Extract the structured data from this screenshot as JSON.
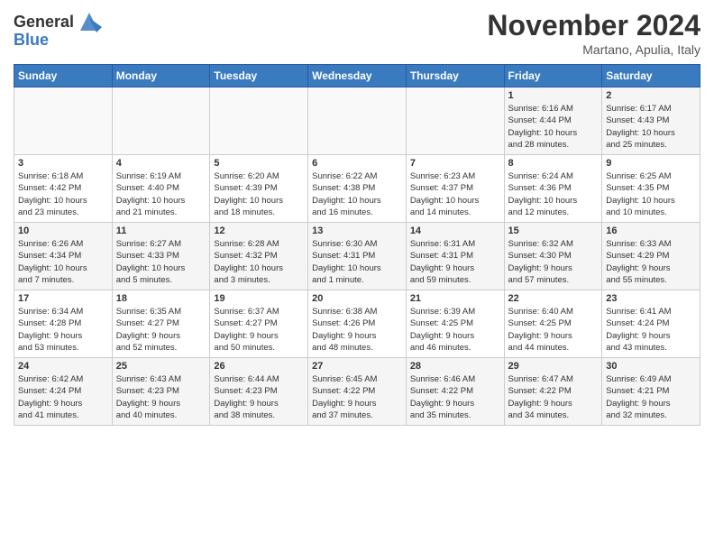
{
  "header": {
    "logo_line1": "General",
    "logo_line2": "Blue",
    "month_title": "November 2024",
    "subtitle": "Martano, Apulia, Italy"
  },
  "days_of_week": [
    "Sunday",
    "Monday",
    "Tuesday",
    "Wednesday",
    "Thursday",
    "Friday",
    "Saturday"
  ],
  "weeks": [
    [
      {
        "day": "",
        "info": ""
      },
      {
        "day": "",
        "info": ""
      },
      {
        "day": "",
        "info": ""
      },
      {
        "day": "",
        "info": ""
      },
      {
        "day": "",
        "info": ""
      },
      {
        "day": "1",
        "info": "Sunrise: 6:16 AM\nSunset: 4:44 PM\nDaylight: 10 hours\nand 28 minutes."
      },
      {
        "day": "2",
        "info": "Sunrise: 6:17 AM\nSunset: 4:43 PM\nDaylight: 10 hours\nand 25 minutes."
      }
    ],
    [
      {
        "day": "3",
        "info": "Sunrise: 6:18 AM\nSunset: 4:42 PM\nDaylight: 10 hours\nand 23 minutes."
      },
      {
        "day": "4",
        "info": "Sunrise: 6:19 AM\nSunset: 4:40 PM\nDaylight: 10 hours\nand 21 minutes."
      },
      {
        "day": "5",
        "info": "Sunrise: 6:20 AM\nSunset: 4:39 PM\nDaylight: 10 hours\nand 18 minutes."
      },
      {
        "day": "6",
        "info": "Sunrise: 6:22 AM\nSunset: 4:38 PM\nDaylight: 10 hours\nand 16 minutes."
      },
      {
        "day": "7",
        "info": "Sunrise: 6:23 AM\nSunset: 4:37 PM\nDaylight: 10 hours\nand 14 minutes."
      },
      {
        "day": "8",
        "info": "Sunrise: 6:24 AM\nSunset: 4:36 PM\nDaylight: 10 hours\nand 12 minutes."
      },
      {
        "day": "9",
        "info": "Sunrise: 6:25 AM\nSunset: 4:35 PM\nDaylight: 10 hours\nand 10 minutes."
      }
    ],
    [
      {
        "day": "10",
        "info": "Sunrise: 6:26 AM\nSunset: 4:34 PM\nDaylight: 10 hours\nand 7 minutes."
      },
      {
        "day": "11",
        "info": "Sunrise: 6:27 AM\nSunset: 4:33 PM\nDaylight: 10 hours\nand 5 minutes."
      },
      {
        "day": "12",
        "info": "Sunrise: 6:28 AM\nSunset: 4:32 PM\nDaylight: 10 hours\nand 3 minutes."
      },
      {
        "day": "13",
        "info": "Sunrise: 6:30 AM\nSunset: 4:31 PM\nDaylight: 10 hours\nand 1 minute."
      },
      {
        "day": "14",
        "info": "Sunrise: 6:31 AM\nSunset: 4:31 PM\nDaylight: 9 hours\nand 59 minutes."
      },
      {
        "day": "15",
        "info": "Sunrise: 6:32 AM\nSunset: 4:30 PM\nDaylight: 9 hours\nand 57 minutes."
      },
      {
        "day": "16",
        "info": "Sunrise: 6:33 AM\nSunset: 4:29 PM\nDaylight: 9 hours\nand 55 minutes."
      }
    ],
    [
      {
        "day": "17",
        "info": "Sunrise: 6:34 AM\nSunset: 4:28 PM\nDaylight: 9 hours\nand 53 minutes."
      },
      {
        "day": "18",
        "info": "Sunrise: 6:35 AM\nSunset: 4:27 PM\nDaylight: 9 hours\nand 52 minutes."
      },
      {
        "day": "19",
        "info": "Sunrise: 6:37 AM\nSunset: 4:27 PM\nDaylight: 9 hours\nand 50 minutes."
      },
      {
        "day": "20",
        "info": "Sunrise: 6:38 AM\nSunset: 4:26 PM\nDaylight: 9 hours\nand 48 minutes."
      },
      {
        "day": "21",
        "info": "Sunrise: 6:39 AM\nSunset: 4:25 PM\nDaylight: 9 hours\nand 46 minutes."
      },
      {
        "day": "22",
        "info": "Sunrise: 6:40 AM\nSunset: 4:25 PM\nDaylight: 9 hours\nand 44 minutes."
      },
      {
        "day": "23",
        "info": "Sunrise: 6:41 AM\nSunset: 4:24 PM\nDaylight: 9 hours\nand 43 minutes."
      }
    ],
    [
      {
        "day": "24",
        "info": "Sunrise: 6:42 AM\nSunset: 4:24 PM\nDaylight: 9 hours\nand 41 minutes."
      },
      {
        "day": "25",
        "info": "Sunrise: 6:43 AM\nSunset: 4:23 PM\nDaylight: 9 hours\nand 40 minutes."
      },
      {
        "day": "26",
        "info": "Sunrise: 6:44 AM\nSunset: 4:23 PM\nDaylight: 9 hours\nand 38 minutes."
      },
      {
        "day": "27",
        "info": "Sunrise: 6:45 AM\nSunset: 4:22 PM\nDaylight: 9 hours\nand 37 minutes."
      },
      {
        "day": "28",
        "info": "Sunrise: 6:46 AM\nSunset: 4:22 PM\nDaylight: 9 hours\nand 35 minutes."
      },
      {
        "day": "29",
        "info": "Sunrise: 6:47 AM\nSunset: 4:22 PM\nDaylight: 9 hours\nand 34 minutes."
      },
      {
        "day": "30",
        "info": "Sunrise: 6:49 AM\nSunset: 4:21 PM\nDaylight: 9 hours\nand 32 minutes."
      }
    ]
  ]
}
